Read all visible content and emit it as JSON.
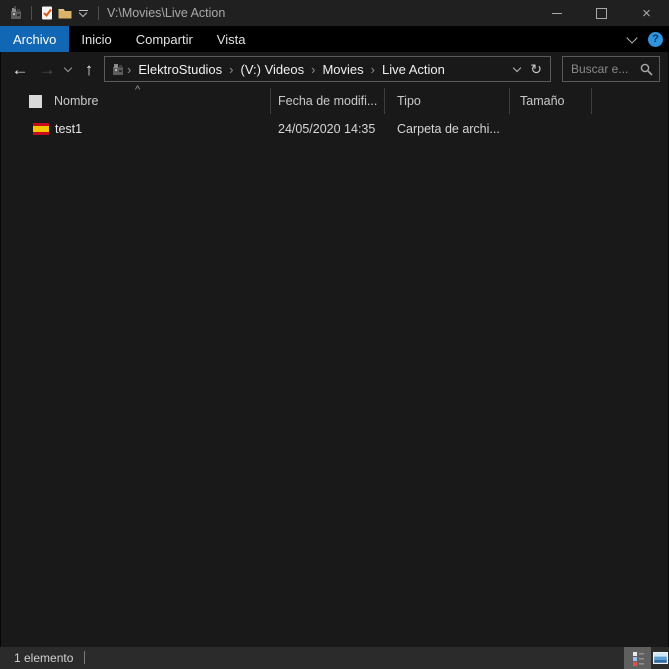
{
  "window": {
    "title": "V:\\Movies\\Live Action"
  },
  "icons": {
    "app": "app-sprite",
    "properties": "document-with-check",
    "new_folder": "folder",
    "qat_dropdown": "chevron-down-with-bar",
    "minimize": "–",
    "maximize": "□",
    "close": "×",
    "ribbon_expand": "chevron-down",
    "help": "?",
    "back": "←",
    "forward": "→",
    "up": "↑",
    "history": "chevron-down",
    "address_dropdown": "chevron-down",
    "refresh": "↻",
    "search": "magnifier",
    "sort_ascending": "^",
    "breadcrumb_sep": "›",
    "file_icon": "spain-flag",
    "view_details": "details-list",
    "view_thumbnails": "picture-thumbnail"
  },
  "ribbon": {
    "tabs": [
      {
        "label": "Archivo",
        "active": true
      },
      {
        "label": "Inicio",
        "active": false
      },
      {
        "label": "Compartir",
        "active": false
      },
      {
        "label": "Vista",
        "active": false
      }
    ]
  },
  "navbar": {
    "breadcrumb": [
      "ElektroStudios",
      "(V:) Videos",
      "Movies",
      "Live Action"
    ],
    "search_placeholder": "Buscar e..."
  },
  "listing": {
    "columns": [
      "Nombre",
      "Fecha de modifi...",
      "Tipo",
      "Tamaño"
    ],
    "rows": [
      {
        "name": "test1",
        "modified": "24/05/2020 14:35",
        "type": "Carpeta de archi...",
        "size": ""
      }
    ]
  },
  "statusbar": {
    "items": "1 elemento"
  },
  "colors": {
    "accent": "#1267b4",
    "background": "#191919",
    "titlebar": "#202020",
    "tab_strip": "#000000",
    "statusbar": "#2b2b2b",
    "flag_red": "#c60b1e",
    "flag_yellow": "#f6c500",
    "help_blue": "#2f94dd"
  }
}
